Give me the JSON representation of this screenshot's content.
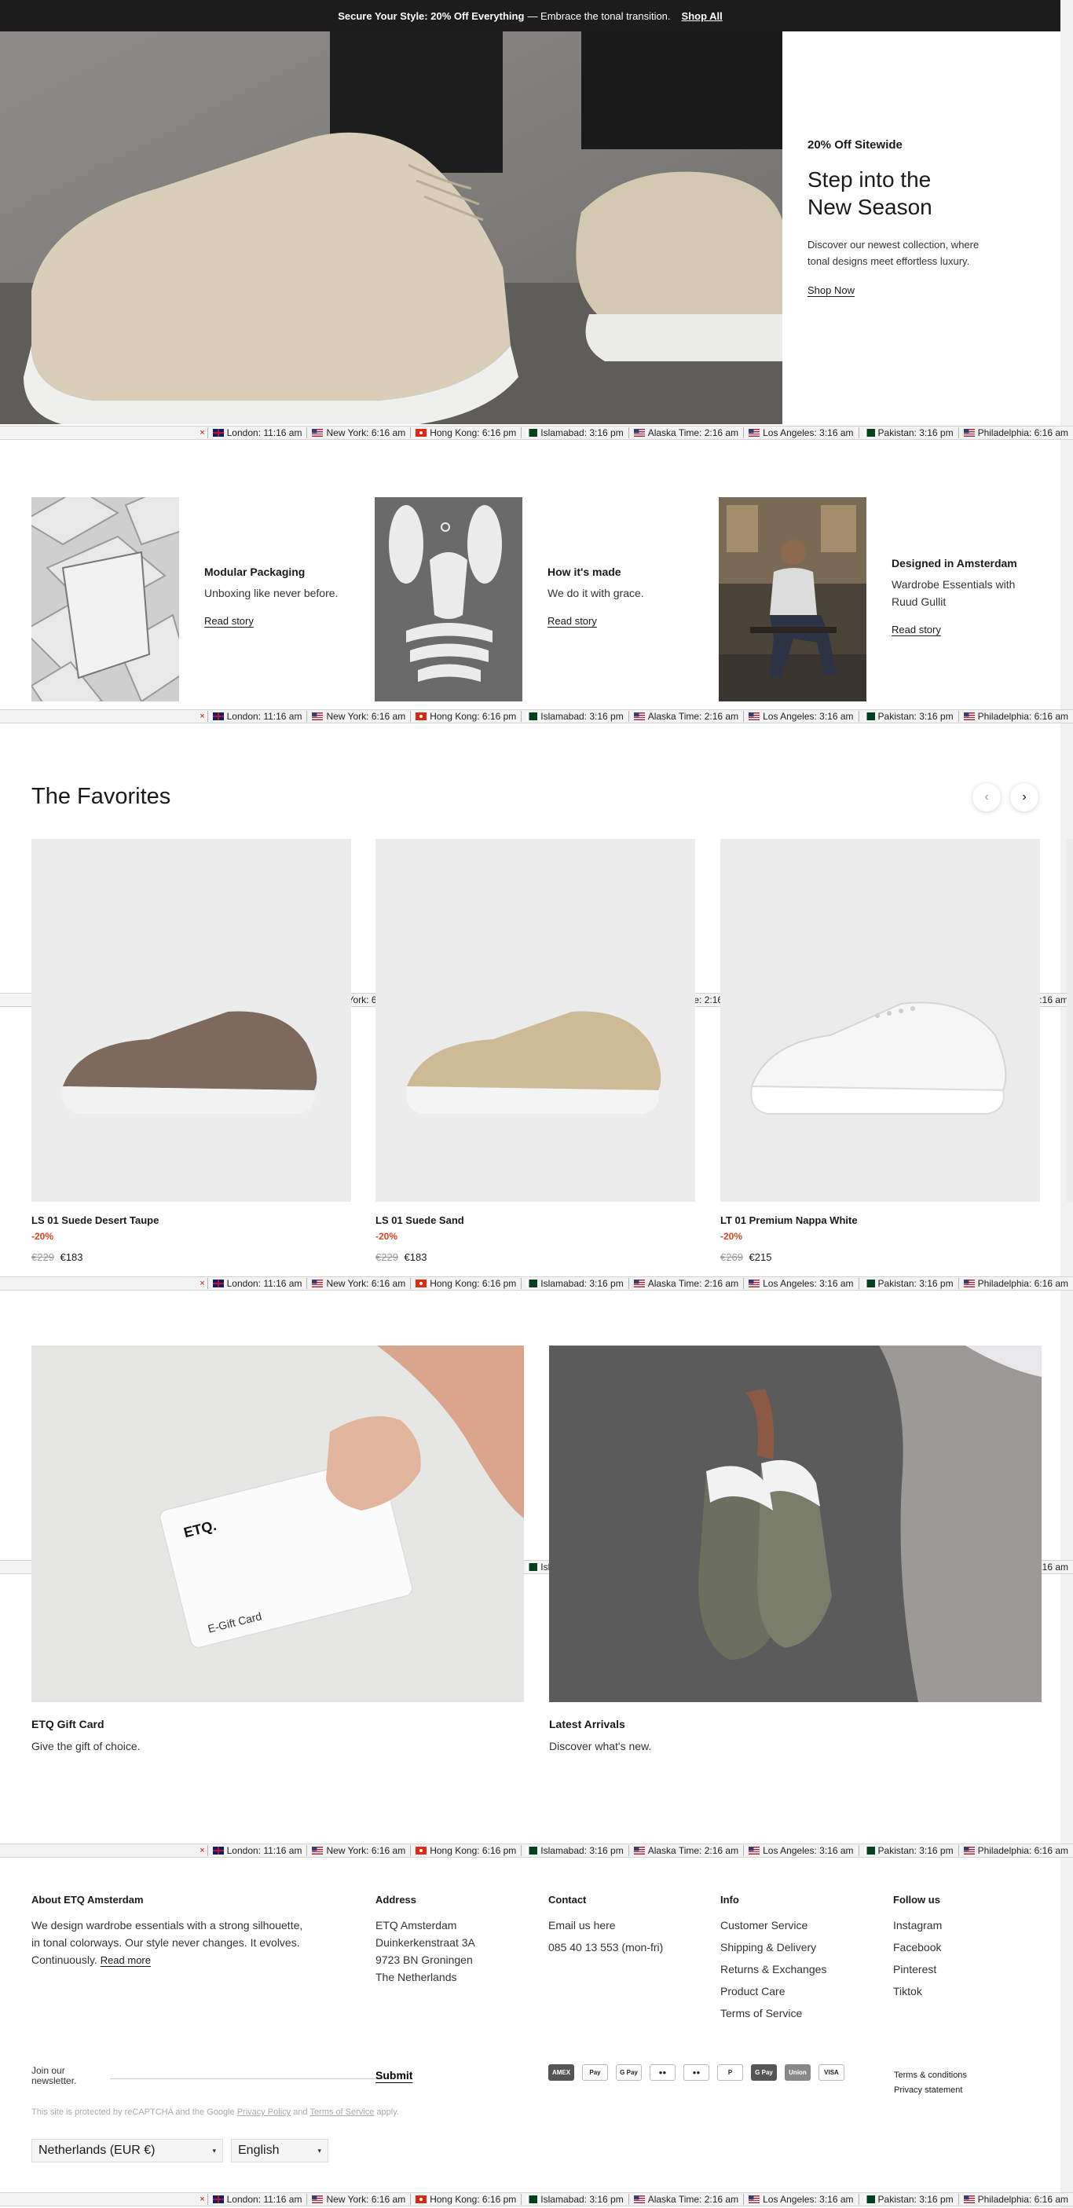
{
  "announcement": {
    "bold": "Secure Your Style: 20% Off Everything",
    "rest": "— Embrace the tonal transition.",
    "link": "Shop All"
  },
  "hero": {
    "kicker": "20% Off Sitewide",
    "title_line1": "Step into the",
    "title_line2": "New Season",
    "desc_line1": "Discover our newest collection, where",
    "desc_line2": "tonal designs meet effortless luxury.",
    "cta": "Shop Now"
  },
  "clock": {
    "close": "×",
    "cities": [
      {
        "flag": "uk",
        "label": "London: 11:16 am"
      },
      {
        "flag": "us",
        "label": "New York: 6:16 am"
      },
      {
        "flag": "hk",
        "label": "Hong Kong: 6:16 pm"
      },
      {
        "flag": "pk",
        "label": "Islamabad: 3:16 pm"
      },
      {
        "flag": "us",
        "label": "Alaska Time: 2:16 am"
      },
      {
        "flag": "us",
        "label": "Los Angeles: 3:16 am"
      },
      {
        "flag": "pk",
        "label": "Pakistan: 3:16 pm"
      },
      {
        "flag": "us",
        "label": "Philadelphia: 6:16 am"
      }
    ]
  },
  "stories": [
    {
      "title": "Modular Packaging",
      "sub_line1": "Unboxing like never before.",
      "sub_line2": "",
      "link": "Read story"
    },
    {
      "title": "How it's made",
      "sub_line1": "We do it with grace.",
      "sub_line2": "",
      "link": "Read story"
    },
    {
      "title": "Designed in Amsterdam",
      "sub_line1": "Wardrobe Essentials with",
      "sub_line2": "Ruud Gullit",
      "link": "Read story"
    }
  ],
  "favorites": {
    "title": "The Favorites",
    "prev_icon": "chevron-left-icon",
    "next_icon": "chevron-right-icon",
    "products": [
      {
        "name": "LS 01 Suede Desert Taupe",
        "discount": "-20%",
        "old_price": "€229",
        "price": "€183",
        "color": "#7d6a5c"
      },
      {
        "name": "LS 01 Suede Sand",
        "discount": "-20%",
        "old_price": "€229",
        "price": "€183",
        "color": "#cdbb98"
      },
      {
        "name": "LT 01 Premium Nappa White",
        "discount": "-20%",
        "old_price": "€269",
        "price": "€215",
        "color": "#f4f4f4"
      }
    ]
  },
  "tiles": [
    {
      "title": "ETQ Gift Card",
      "sub": "Give the gift of choice.",
      "card_brand": "ETQ.",
      "card_label": "E-Gift Card"
    },
    {
      "title": "Latest Arrivals",
      "sub": "Discover what's new."
    }
  ],
  "footer": {
    "about": {
      "head": "About ETQ Amsterdam",
      "line1": "We design wardrobe essentials with a strong silhouette,",
      "line2": "in tonal colorways. Our style never changes. It evolves.",
      "line3": "Continuously.",
      "link": "Read more"
    },
    "address": {
      "head": "Address",
      "lines": [
        "ETQ Amsterdam",
        "Duinkerkenstraat 3A",
        "9723 BN Groningen",
        "The Netherlands"
      ]
    },
    "contact": {
      "head": "Contact",
      "email": "Email us here",
      "phone": "085 40 13 553 (mon-fri)"
    },
    "info": {
      "head": "Info",
      "items": [
        "Customer Service",
        "Shipping & Delivery",
        "Returns & Exchanges",
        "Product Care",
        "Terms of Service"
      ]
    },
    "follow": {
      "head": "Follow us",
      "items": [
        "Instagram",
        "Facebook",
        "Pinterest",
        "Tiktok"
      ]
    },
    "newsletter": {
      "label_line1": "Join our",
      "label_line2": "newsletter.",
      "placeholder": "",
      "submit": "Submit"
    },
    "payments": [
      "AMEX",
      "Pay",
      "G Pay",
      "●●",
      "●●",
      "P",
      "G Pay",
      "Union",
      "VISA"
    ],
    "legal": [
      "Terms & conditions",
      "Privacy statement"
    ],
    "recaptcha": {
      "pre": "This site is protected by reCAPTCHA and the Google ",
      "privacy": "Privacy Policy",
      "and": " and ",
      "terms": "Terms of Service",
      "post": " apply."
    },
    "currency": "Netherlands (EUR €)",
    "language": "English"
  }
}
